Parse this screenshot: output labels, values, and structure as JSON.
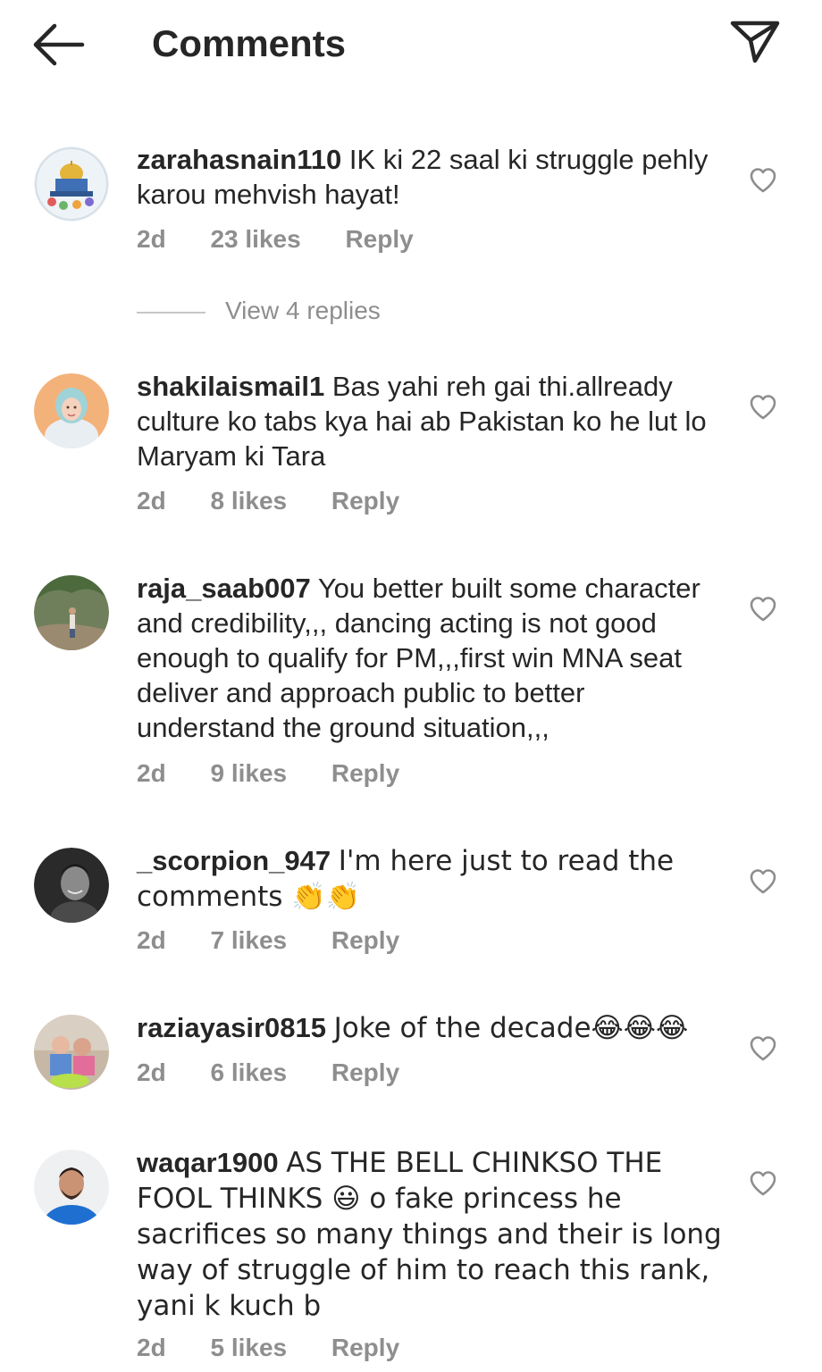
{
  "header": {
    "title": "Comments"
  },
  "comments": [
    {
      "username": "zarahasnain110",
      "text": "IK ki 22 saal ki struggle pehly karou mehvish hayat!",
      "age": "2d",
      "likes": "23 likes",
      "reply": "Reply",
      "view_replies": "View 4 replies",
      "avatar_icon": "dome-of-the-rock-illustration"
    },
    {
      "username": "shakilaismail1",
      "text": "Bas yahi reh gai thi.allready culture ko tabs kya hai ab Pakistan ko he lut lo Maryam ki Tara",
      "age": "2d",
      "likes": "8 likes",
      "reply": "Reply",
      "avatar_icon": "woman-in-headscarf-photo"
    },
    {
      "username": "raja_saab007",
      "text": "You better built some character and credibility,,, dancing acting is not good enough to qualify for PM,,,first win MNA seat deliver and approach public to better understand the ground situation,,,",
      "age": "2d",
      "likes": "9 likes",
      "reply": "Reply",
      "avatar_icon": "man-in-forest-photo"
    },
    {
      "username": "_scorpion_947",
      "text": "I'm here just to read the comments 👏👏",
      "age": "2d",
      "likes": "7 likes",
      "reply": "Reply",
      "avatar_icon": "man-black-and-white-photo"
    },
    {
      "username": "raziayasir0815",
      "text": "Joke of the decade😂😂😂",
      "age": "2d",
      "likes": "6 likes",
      "reply": "Reply",
      "avatar_icon": "children-photo"
    },
    {
      "username": "waqar1900",
      "text": "AS THE BELL CHINKSO THE FOOL THINKS 😃 o fake princess  he sacrifices so many things and their is long way of struggle of him to reach this  rank, yani k kuch b",
      "age": "2d",
      "likes": "5 likes",
      "reply": "Reply",
      "avatar_icon": "man-blue-shirt-photo"
    }
  ],
  "colors": {
    "text": "#262626",
    "muted": "#8e8e8e",
    "divider": "#c7c7c7",
    "background": "#ffffff"
  }
}
